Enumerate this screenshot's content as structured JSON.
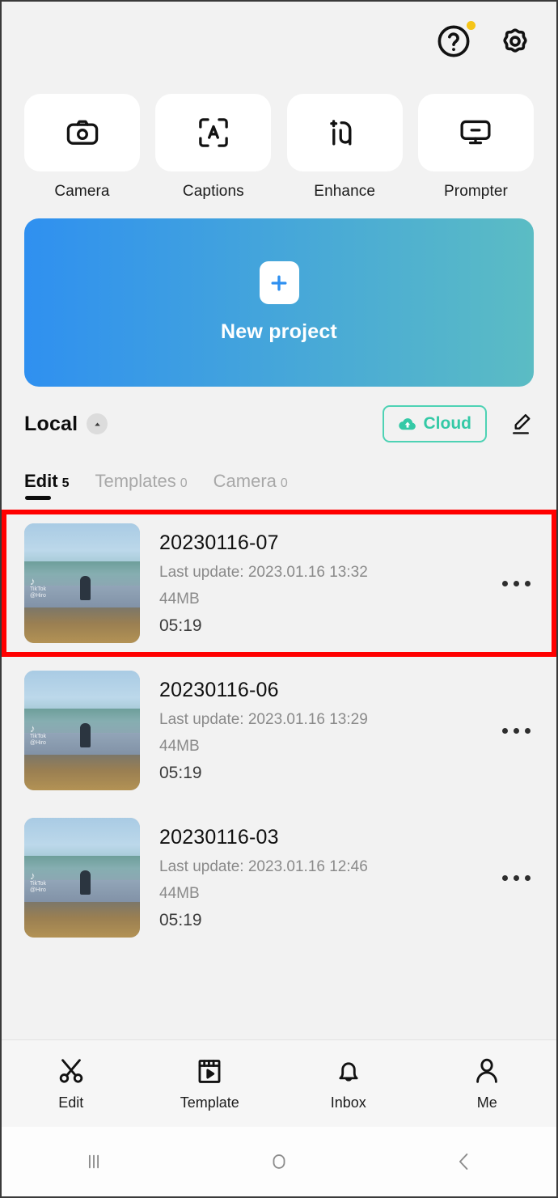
{
  "header": {
    "help_icon": "help-circle-icon",
    "help_badge": true,
    "settings_icon": "gear-icon",
    "badge_color": "#f5c518"
  },
  "feature_tiles": [
    {
      "label": "Camera",
      "icon": "camera-icon"
    },
    {
      "label": "Captions",
      "icon": "captions-icon"
    },
    {
      "label": "Enhance",
      "icon": "enhance-icon"
    },
    {
      "label": "Prompter",
      "icon": "prompter-icon"
    }
  ],
  "new_project": {
    "label": "New project",
    "icon": "plus-icon",
    "gradient_from": "#2f90f0",
    "gradient_to": "#5bbcc4"
  },
  "library": {
    "title": "Local",
    "collapse_icon": "chevron-up-icon",
    "cloud_button": {
      "label": "Cloud",
      "icon": "cloud-upload-icon",
      "color": "#34c9a6"
    },
    "edit_icon": "pencil-icon"
  },
  "tabs": [
    {
      "label": "Edit",
      "count": "5",
      "active": true
    },
    {
      "label": "Templates",
      "count": "0",
      "active": false
    },
    {
      "label": "Camera",
      "count": "0",
      "active": false
    }
  ],
  "projects": [
    {
      "title": "20230116-07",
      "last_update": "Last update: 2023.01.16 13:32",
      "size": "44MB",
      "duration": "05:19",
      "more_icon": "more-horizontal-icon",
      "highlighted": true,
      "watermark": {
        "logo": "tiktok-icon",
        "line1": "TikTok",
        "line2": "@Hiro"
      }
    },
    {
      "title": "20230116-06",
      "last_update": "Last update: 2023.01.16 13:29",
      "size": "44MB",
      "duration": "05:19",
      "more_icon": "more-horizontal-icon",
      "highlighted": false,
      "watermark": {
        "logo": "tiktok-icon",
        "line1": "TikTok",
        "line2": "@Hiro"
      }
    },
    {
      "title": "20230116-03",
      "last_update": "Last update: 2023.01.16 12:46",
      "size": "44MB",
      "duration": "05:19",
      "more_icon": "more-horizontal-icon",
      "highlighted": false,
      "watermark": {
        "logo": "tiktok-icon",
        "line1": "TikTok",
        "line2": "@Hiro"
      }
    }
  ],
  "highlight": {
    "color": "#ff0000"
  },
  "bottom_nav": [
    {
      "label": "Edit",
      "icon": "scissors-icon"
    },
    {
      "label": "Template",
      "icon": "clapperboard-play-icon"
    },
    {
      "label": "Inbox",
      "icon": "bell-icon"
    },
    {
      "label": "Me",
      "icon": "person-icon"
    }
  ],
  "system_bar": [
    {
      "icon": "recents-icon"
    },
    {
      "icon": "home-icon"
    },
    {
      "icon": "back-icon"
    }
  ]
}
